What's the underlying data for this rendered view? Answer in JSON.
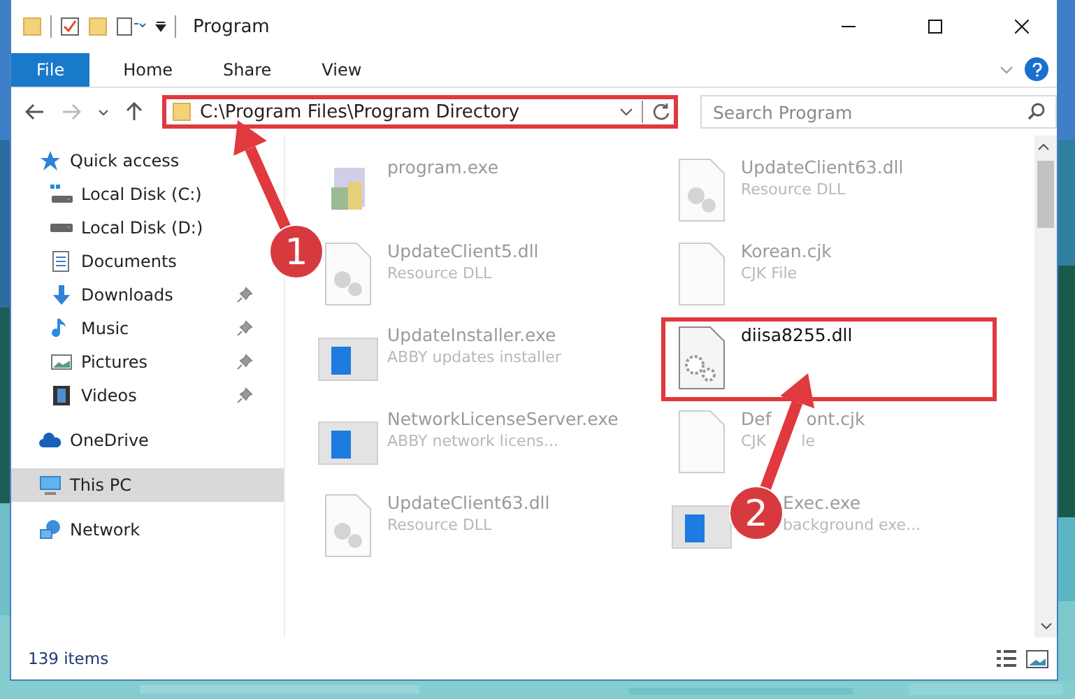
{
  "window": {
    "title": "Program"
  },
  "ribbon_tabs": [
    {
      "label": "File",
      "selected": true
    },
    {
      "label": "Home",
      "selected": false
    },
    {
      "label": "Share",
      "selected": false
    },
    {
      "label": "View",
      "selected": false
    }
  ],
  "address": {
    "path": "C:\\Program Files\\Program Directory",
    "highlighted": true
  },
  "search": {
    "placeholder": "Search Program"
  },
  "sidebar": {
    "items": [
      {
        "label": "Quick access",
        "kind": "star",
        "selected": false,
        "children": [
          {
            "label": "Local Disk (C:)",
            "kind": "drive-c",
            "pinned": false
          },
          {
            "label": "Local Disk (D:)",
            "kind": "drive",
            "pinned": false
          },
          {
            "label": "Documents",
            "kind": "documents",
            "pinned": false
          },
          {
            "label": "Downloads",
            "kind": "downloads",
            "pinned": true
          },
          {
            "label": "Music",
            "kind": "music",
            "pinned": true
          },
          {
            "label": "Pictures",
            "kind": "pictures",
            "pinned": true
          },
          {
            "label": "Videos",
            "kind": "videos",
            "pinned": true
          }
        ]
      },
      {
        "label": "OneDrive",
        "kind": "cloud",
        "selected": false
      },
      {
        "label": "This PC",
        "kind": "pc",
        "selected": true
      },
      {
        "label": "Network",
        "kind": "network",
        "selected": false
      }
    ]
  },
  "files": [
    {
      "name": [
        "program.exe"
      ],
      "kind": "installer",
      "blurred": true,
      "highlighted": false,
      "covered": false
    },
    {
      "name": [
        "UpdateClient63.dll"
      ],
      "type": [
        "Resource DLL"
      ],
      "kind": "dll",
      "blurred": true,
      "highlighted": false,
      "covered": false
    },
    {
      "name": [
        "UpdateClient5.dll"
      ],
      "type": [
        "Resource DLL"
      ],
      "kind": "dll",
      "blurred": true,
      "highlighted": false,
      "covered": false
    },
    {
      "name": [
        "Korean.cjk"
      ],
      "type": [
        "CJK File"
      ],
      "kind": "file",
      "blurred": true,
      "highlighted": false,
      "covered": false
    },
    {
      "name": [
        "UpdateInstaller.exe"
      ],
      "type": [
        "ABBY updates installer"
      ],
      "kind": "app",
      "blurred": true,
      "highlighted": false,
      "covered": false
    },
    {
      "name": [
        "diisa8255.dll"
      ],
      "kind": "gear",
      "blurred": false,
      "highlighted": true,
      "covered": false
    },
    {
      "name": [
        "NetworkLicenseServer.exe"
      ],
      "type": [
        "ABBY network licens..."
      ],
      "kind": "app",
      "blurred": true,
      "highlighted": false,
      "covered": false
    },
    {
      "name": [
        "Def",
        "ont.cjk"
      ],
      "type": [
        "CJK",
        "le"
      ],
      "kind": "file",
      "blurred": true,
      "highlighted": false,
      "covered": false
    },
    {
      "name": [
        "UpdateClient63.dll"
      ],
      "type": [
        "Resource DLL"
      ],
      "kind": "dll",
      "blurred": true,
      "highlighted": false,
      "covered": false
    },
    {
      "name": [
        "Exec.exe"
      ],
      "type": [
        "background exe..."
      ],
      "kind": "app",
      "blurred": true,
      "highlighted": false,
      "covered": true
    }
  ],
  "status_bar": {
    "count": "139 items"
  },
  "annotations": [
    {
      "number": "1"
    },
    {
      "number": "2"
    }
  ]
}
